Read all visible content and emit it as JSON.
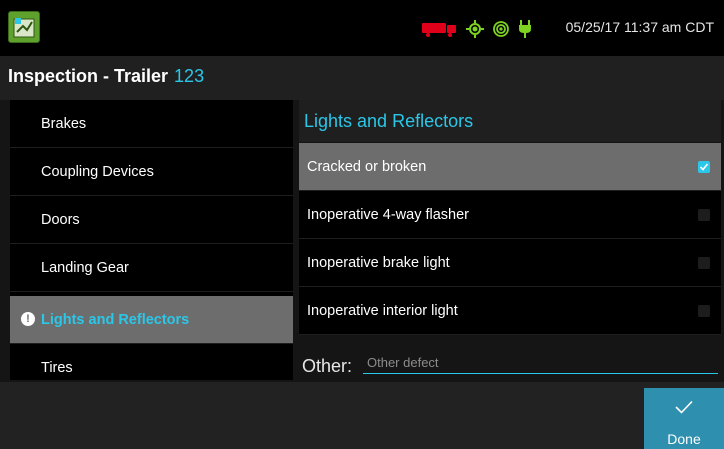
{
  "status": {
    "datetime": "05/25/17 11:37 am CDT"
  },
  "header": {
    "title": "Inspection - Trailer",
    "unit": "123"
  },
  "sidebar": {
    "items": [
      {
        "label": "Brakes"
      },
      {
        "label": "Coupling Devices"
      },
      {
        "label": "Doors"
      },
      {
        "label": "Landing Gear"
      },
      {
        "label": "Lights and Reflectors",
        "active": true,
        "alert": "!"
      },
      {
        "label": "Tires"
      }
    ]
  },
  "panel": {
    "title": "Lights and Reflectors",
    "defects": [
      {
        "label": "Cracked or broken",
        "checked": true
      },
      {
        "label": "Inoperative 4-way flasher",
        "checked": false
      },
      {
        "label": "Inoperative brake light",
        "checked": false
      },
      {
        "label": "Inoperative interior light",
        "checked": false
      }
    ],
    "other_label": "Other:",
    "other_placeholder": "Other defect",
    "other_value": ""
  },
  "footer": {
    "done_label": "Done"
  },
  "colors": {
    "accent": "#2bc7e8",
    "done_button": "#2e8fae",
    "truck_status": "#e0001a",
    "gps_status": "#7ed321"
  },
  "icons": [
    "app-icon",
    "truck-icon",
    "gps-icon",
    "signal-icon",
    "power-icon",
    "alert-icon",
    "checkmark-icon"
  ]
}
